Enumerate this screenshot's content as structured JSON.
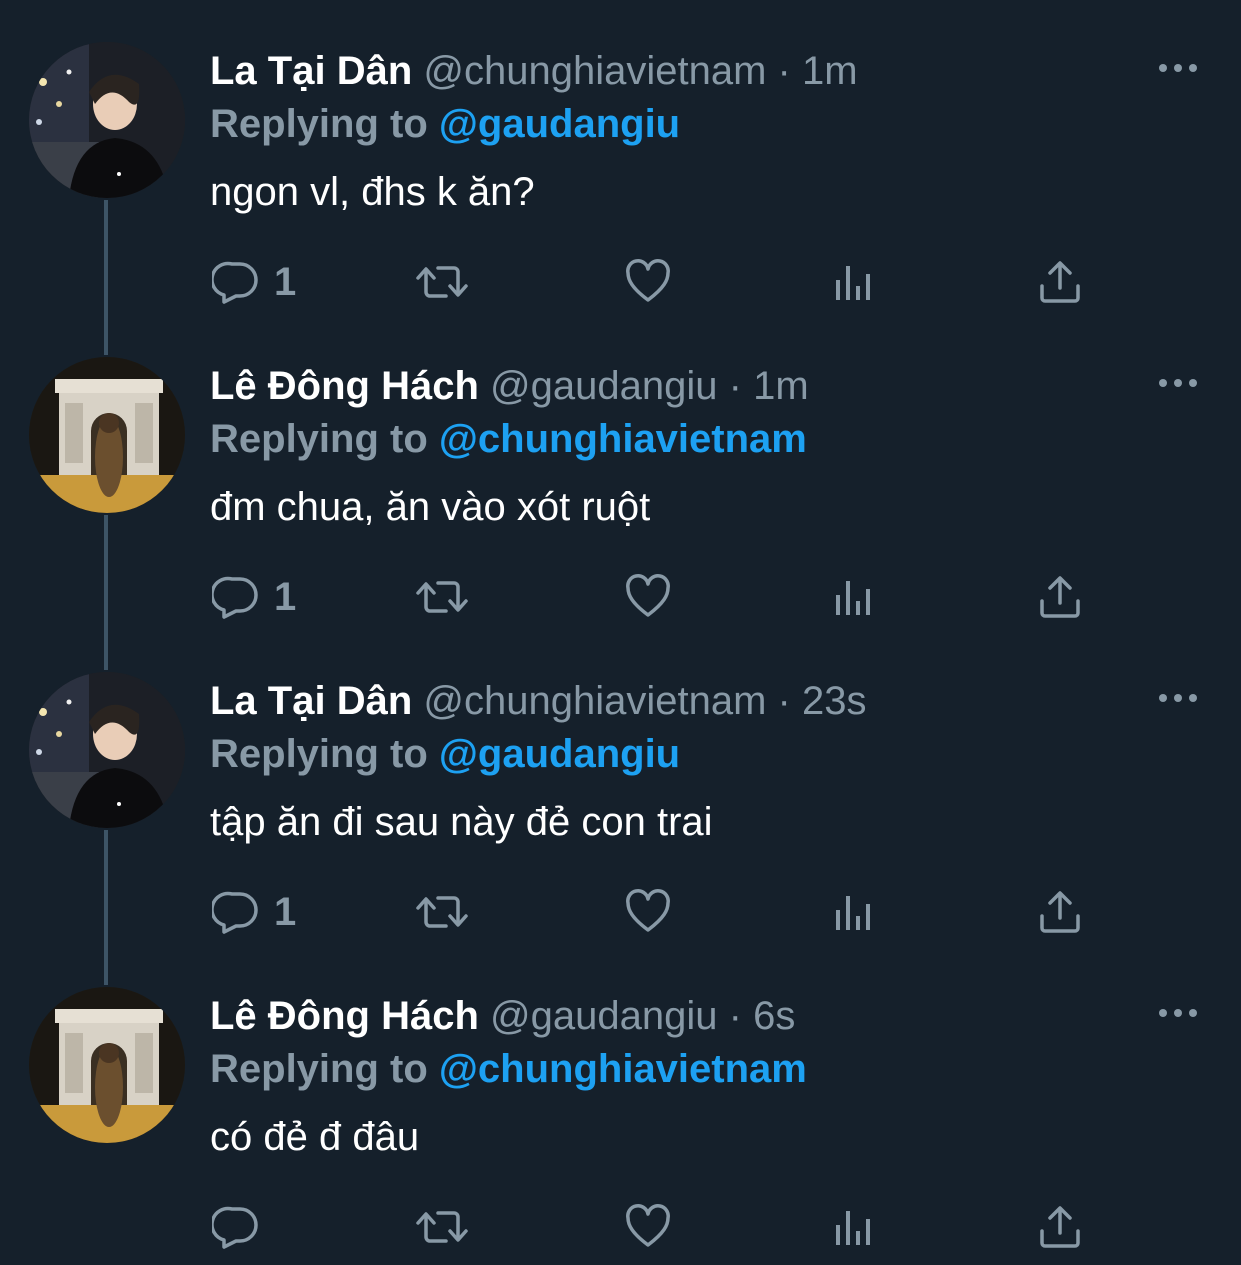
{
  "tweets": [
    {
      "name": "La Tại Dân",
      "handle": "@chunghiavietnam",
      "separator": "·",
      "time": "1m",
      "replying_label": "Replying to",
      "replying_to": "@gaudangiu",
      "text": "ngon vl, đhs k ăn?",
      "reply_count": "1",
      "avatar": "avatar-boy-night-street"
    },
    {
      "name": "Lê Đông Hách",
      "handle": "@gaudangiu",
      "separator": "·",
      "time": "1m",
      "replying_label": "Replying to",
      "replying_to": "@chunghiavietnam",
      "text": "đm chua, ăn vào xót ruột",
      "reply_count": "1",
      "avatar": "avatar-arc-de-triomphe"
    },
    {
      "name": "La Tại Dân",
      "handle": "@chunghiavietnam",
      "separator": "·",
      "time": "23s",
      "replying_label": "Replying to",
      "replying_to": "@gaudangiu",
      "text": "tập ăn đi sau này đẻ con trai",
      "reply_count": "1",
      "avatar": "avatar-boy-night-street"
    },
    {
      "name": "Lê Đông Hách",
      "handle": "@gaudangiu",
      "separator": "·",
      "time": "6s",
      "replying_label": "Replying to",
      "replying_to": "@chunghiavietnam",
      "text": "có đẻ đ đâu",
      "reply_count": "",
      "avatar": "avatar-arc-de-triomphe"
    }
  ],
  "icons": {
    "reply": "reply-icon",
    "retweet": "retweet-icon",
    "like": "heart-icon",
    "stats": "analytics-icon",
    "share": "share-icon",
    "more": "more-icon"
  },
  "colors": {
    "background": "#15202b",
    "text": "#ffffff",
    "muted": "#8899a6",
    "accent": "#1da1f2",
    "thread_line": "#3d5466"
  }
}
